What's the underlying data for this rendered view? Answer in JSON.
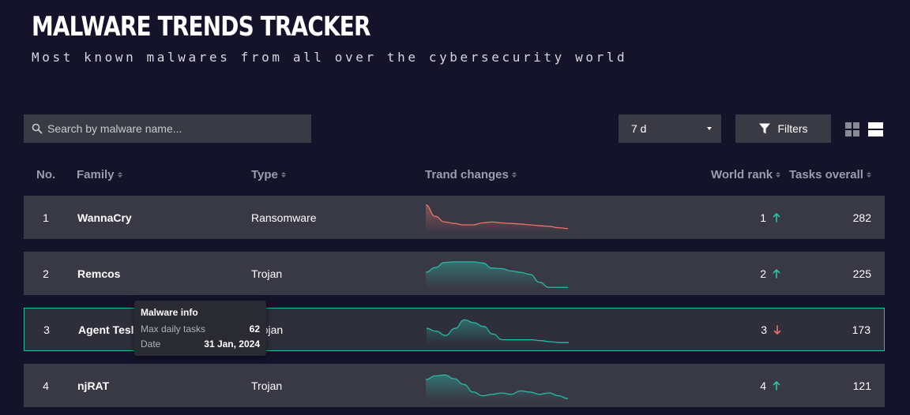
{
  "header": {
    "title": "MALWARE TRENDS TRACKER",
    "subtitle": "Most known malwares from all over the cybersecurity world"
  },
  "toolbar": {
    "search_placeholder": "Search by malware name...",
    "period_value": "7 d",
    "filters_label": "Filters",
    "grid_view_icon": "grid-icon",
    "list_view_icon": "list-icon",
    "active_view": "list"
  },
  "columns": {
    "no": "No.",
    "family": "Family",
    "type": "Type",
    "trend": "Trand changes",
    "rank": "World rank",
    "tasks": "Tasks overall"
  },
  "colors": {
    "background": "#14132a",
    "row": "#393945",
    "accent_teal": "#2bb7a6",
    "trend_red": "#e8736a",
    "rank_up": "#2bc4a8",
    "rank_down": "#f0706a"
  },
  "rows": [
    {
      "no": "1",
      "family": "WannaCry",
      "type": "Ransomware",
      "rank": "1",
      "rank_dir": "up",
      "tasks": "282",
      "trend_color": "red",
      "trend": [
        0.95,
        0.55,
        0.35,
        0.3,
        0.25,
        0.25,
        0.32,
        0.35,
        0.32,
        0.3,
        0.28,
        0.25,
        0.22,
        0.2,
        0.15,
        0.12
      ]
    },
    {
      "no": "2",
      "family": "Remcos",
      "type": "Trojan",
      "rank": "2",
      "rank_dir": "up",
      "tasks": "225",
      "trend_color": "teal",
      "trend": [
        0.55,
        0.72,
        0.9,
        0.92,
        0.92,
        0.92,
        0.88,
        0.7,
        0.68,
        0.6,
        0.55,
        0.48,
        0.2,
        0.02,
        0.02,
        0.02
      ]
    },
    {
      "no": "3",
      "family": "Agent Tesla",
      "type": "Trojan",
      "rank": "3",
      "rank_dir": "down",
      "tasks": "173",
      "trend_color": "teal",
      "selected": true,
      "trend": [
        0.55,
        0.45,
        0.3,
        0.55,
        0.85,
        0.75,
        0.62,
        0.35,
        0.15,
        0.15,
        0.15,
        0.15,
        0.12,
        0.08,
        0.05,
        0.05
      ]
    },
    {
      "no": "4",
      "family": "njRAT",
      "type": "Trojan",
      "rank": "4",
      "rank_dir": "up",
      "tasks": "121",
      "trend_color": "teal",
      "trend": [
        0.72,
        0.85,
        0.88,
        0.75,
        0.55,
        0.28,
        0.15,
        0.2,
        0.25,
        0.2,
        0.32,
        0.28,
        0.2,
        0.25,
        0.15,
        0.05
      ]
    }
  ],
  "tooltip": {
    "title": "Malware info",
    "max_label": "Max daily tasks",
    "max_value": "62",
    "date_label": "Date",
    "date_value": "31 Jan, 2024"
  }
}
